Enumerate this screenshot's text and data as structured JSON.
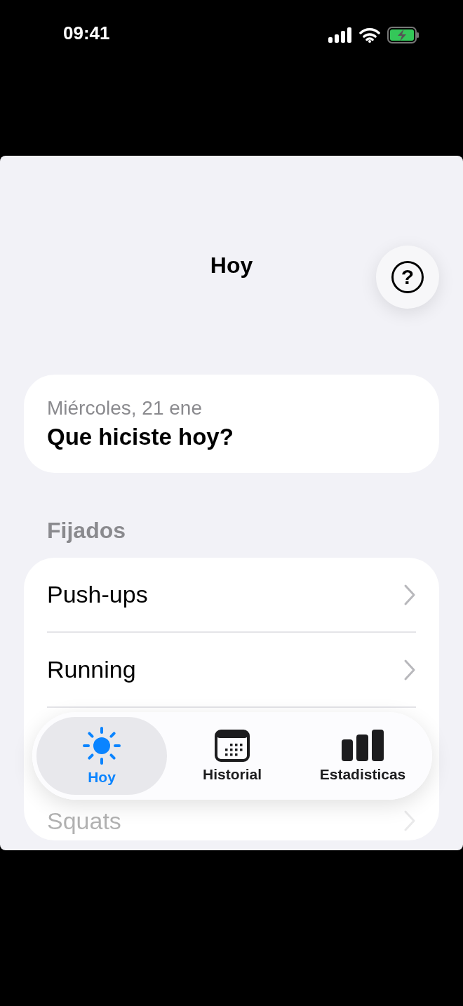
{
  "status_bar": {
    "time": "09:41"
  },
  "header": {
    "title": "Hoy",
    "help_button": "?"
  },
  "today_card": {
    "date": "Miércoles, 21 ene",
    "prompt": "Que hiciste hoy?"
  },
  "pinned": {
    "heading": "Fijados",
    "items": [
      {
        "label": "Push-ups",
        "faded": false
      },
      {
        "label": "Running",
        "faded": false
      },
      {
        "label": "Squats",
        "faded": true
      }
    ]
  },
  "tab_bar": [
    {
      "label": "Hoy",
      "kind": "sun",
      "selected": true
    },
    {
      "label": "Historial",
      "kind": "calendar",
      "selected": false
    },
    {
      "label": "Estadisticas",
      "kind": "chart",
      "selected": false
    }
  ]
}
